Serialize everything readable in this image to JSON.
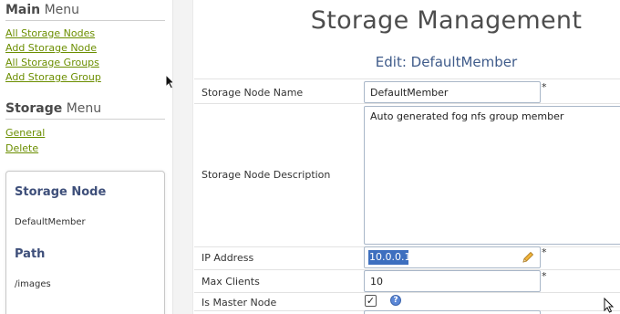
{
  "sidebar": {
    "main_menu": {
      "title_bold": "Main",
      "title_rest": " Menu",
      "links": [
        "All Storage Nodes",
        "Add Storage Node",
        "All Storage Groups",
        "Add Storage Group"
      ]
    },
    "storage_menu": {
      "title_bold": "Storage",
      "title_rest": " Menu",
      "links": [
        "General",
        "Delete"
      ]
    },
    "info_box": {
      "node_title": "Storage Node",
      "node_value": "DefaultMember",
      "path_title": "Path",
      "path_value": "/images"
    }
  },
  "main": {
    "title": "Storage Management",
    "edit_heading": "Edit: DefaultMember",
    "fields": {
      "name_label": "Storage Node Name",
      "name_value": "DefaultMember",
      "desc_label": "Storage Node Description",
      "desc_value": "Auto generated fog nfs group member",
      "ip_label": "IP Address",
      "ip_value": "10.0.0.1",
      "max_label": "Max Clients",
      "max_value": "10",
      "master_label": "Is Master Node",
      "master_checked": true
    },
    "required_marker": "*",
    "help_glyph": "?",
    "check_glyph": "✓"
  },
  "icons": [
    "pencil-icon",
    "help-icon",
    "checkmark-icon",
    "mouse-cursor-icon"
  ],
  "colors": {
    "link": "#6b8e00",
    "heading_blue": "#3f5b8a",
    "info_title": "#3e4f7a",
    "selection": "#3d6fbf",
    "help": "#5b87d6"
  }
}
